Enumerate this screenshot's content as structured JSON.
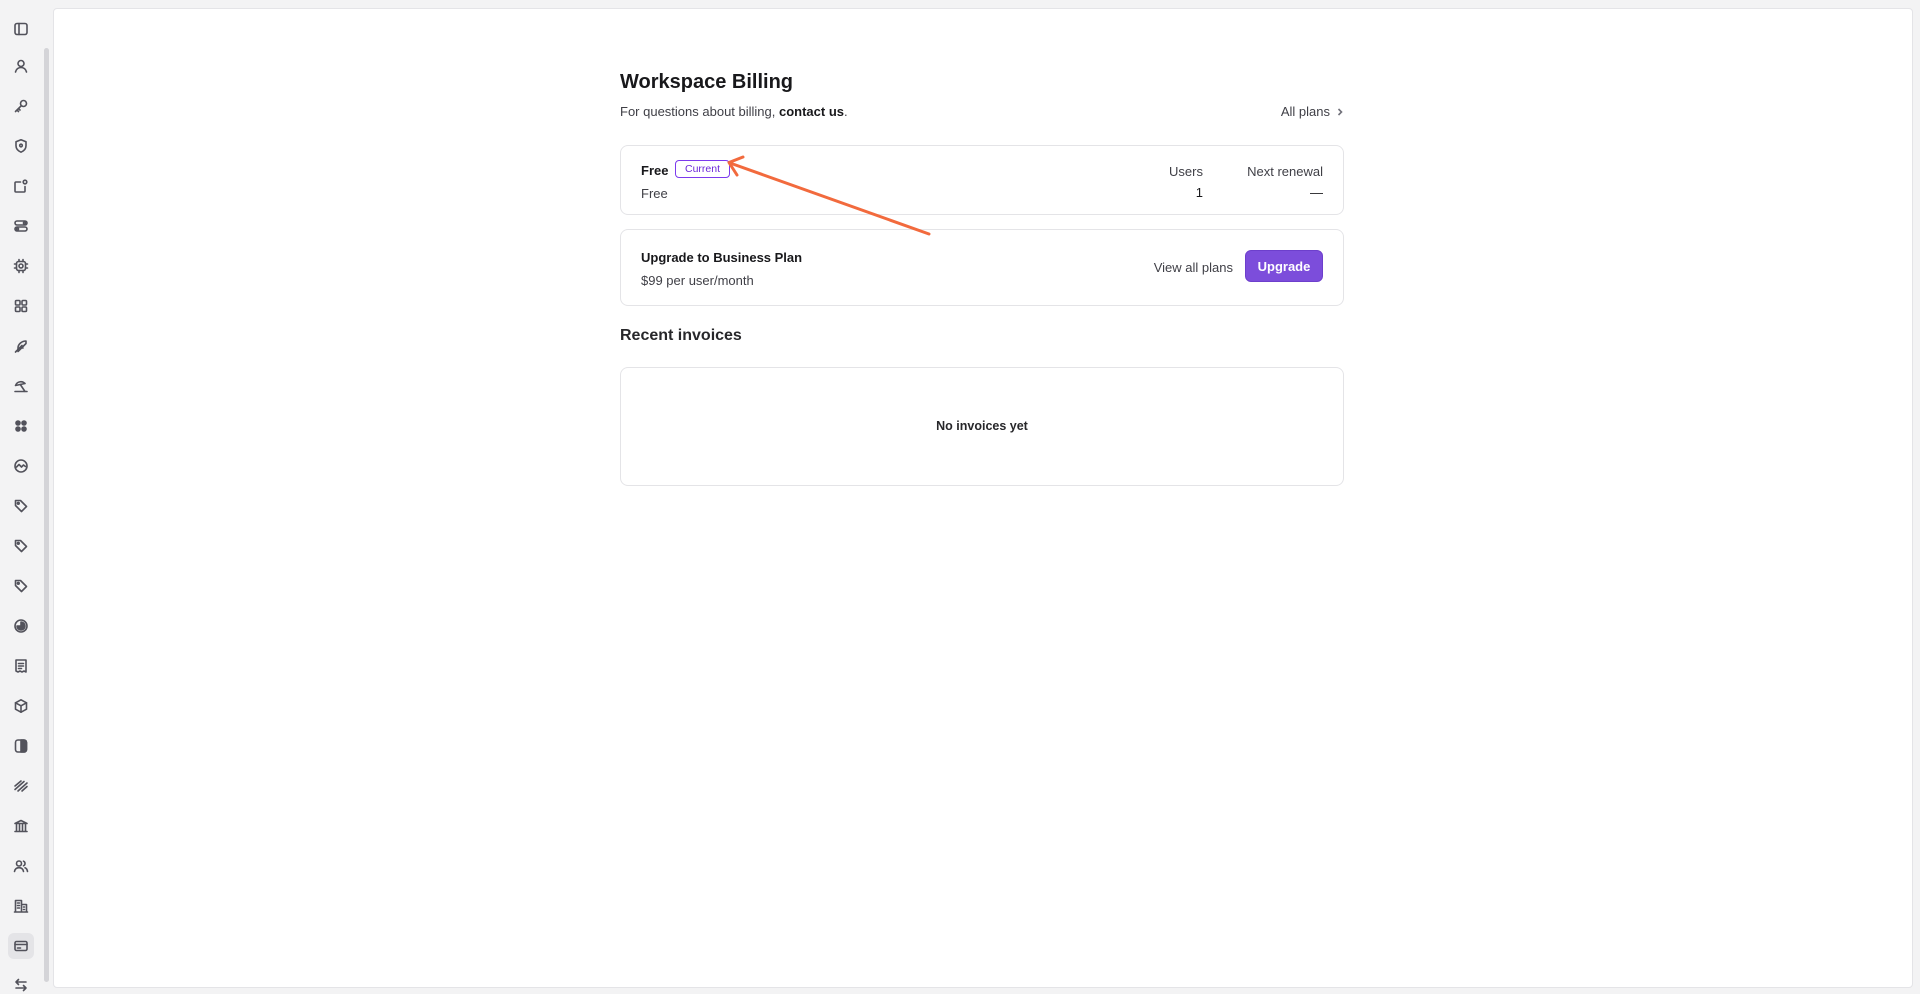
{
  "sidebar": {
    "items": [
      {
        "icon": "sidebar-toggle-icon"
      },
      {
        "icon": "user-icon"
      },
      {
        "icon": "key-icon"
      },
      {
        "icon": "shield-icon"
      },
      {
        "icon": "notification-icon"
      },
      {
        "icon": "toggles-icon"
      },
      {
        "icon": "chip-icon"
      },
      {
        "icon": "apps-grid-icon"
      },
      {
        "icon": "feather-icon"
      },
      {
        "icon": "beach-umbrella-icon"
      },
      {
        "icon": "clover-icon"
      },
      {
        "icon": "activity-icon"
      },
      {
        "icon": "tag-icon"
      },
      {
        "icon": "tag-icon"
      },
      {
        "icon": "tag-icon"
      },
      {
        "icon": "pie-icon"
      },
      {
        "icon": "document-list-icon"
      },
      {
        "icon": "cube-icon"
      },
      {
        "icon": "contrast-icon"
      },
      {
        "icon": "stripes-icon"
      },
      {
        "icon": "bank-icon"
      },
      {
        "icon": "team-icon"
      },
      {
        "icon": "building-icon"
      },
      {
        "icon": "credit-card-icon"
      },
      {
        "icon": "arrows-exchange-icon"
      }
    ],
    "active_icon": "credit-card-icon"
  },
  "page": {
    "title": "Workspace Billing",
    "subtitle_prefix": "For questions about billing, ",
    "subtitle_link": "contact us",
    "subtitle_suffix": ".",
    "all_plans_link": "All plans"
  },
  "current_plan": {
    "name": "Free",
    "badge": "Current",
    "price_label": "Free",
    "users_label": "Users",
    "users_value": "1",
    "renewal_label": "Next renewal",
    "renewal_value": "—"
  },
  "upgrade": {
    "title": "Upgrade to Business Plan",
    "price": "$99 per user/month",
    "view_all_label": "View all plans",
    "button_label": "Upgrade"
  },
  "invoices": {
    "section_title": "Recent invoices",
    "empty_text": "No invoices yet"
  },
  "colors": {
    "accent": "#7c4ddb",
    "annotation_arrow": "#f26a3d"
  }
}
